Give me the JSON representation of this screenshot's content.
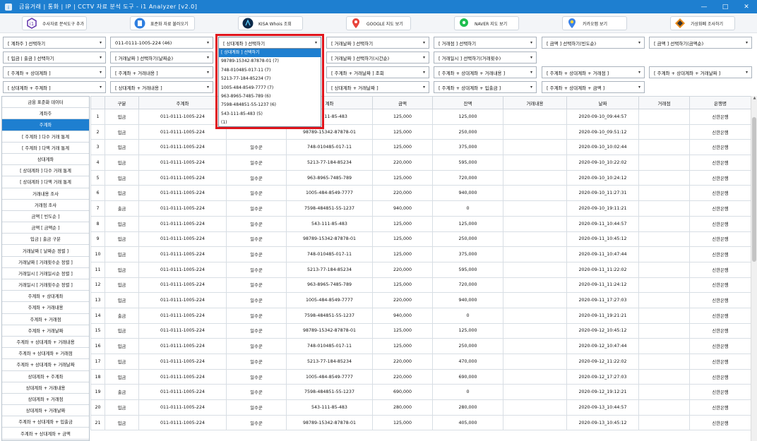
{
  "window": {
    "title": "금융거래 | 통화 | IP | CCTV 자료 분석 도구 - i1 Analyzer [v2.0]",
    "minimize": "—",
    "maximize": "□",
    "close": "✕"
  },
  "toolbar": {
    "buttons": [
      {
        "label": "수사자료 분석도구 추가",
        "icon": "i1-logo-icon"
      },
      {
        "label": "표준화 자료 불러오기",
        "icon": "document-icon"
      },
      {
        "label": "KISA Whois 조회",
        "icon": "kisa-logo-icon"
      },
      {
        "label": "GOOGLE 지도 보기",
        "icon": "google-maps-icon"
      },
      {
        "label": "NAVER 지도 보기",
        "icon": "naver-map-icon"
      },
      {
        "label": "카카오맵 보기",
        "icon": "kakao-map-icon"
      },
      {
        "label": "가상화폐 조사하기",
        "icon": "crypto-icon"
      }
    ]
  },
  "filters": {
    "row1": [
      "[ 계좌주 ] 선택하기",
      "011-0111-1005-224 (46)",
      "[ 상대계좌 ] 선택하기",
      "[ 거래날짜 ] 선택하기",
      "[ 거래점 ] 선택하기",
      "[ 금액 ] 선택하기(빈도순)",
      "[ 금액 ] 선택하기(금액순)"
    ],
    "row2": [
      "[ 입금 | 출금 ] 선택하기",
      "[ 거래날짜 ] 선택하기(날짜순)",
      "",
      "[ 거래날짜 ] 선택하기(시간순)",
      "[ 거래일시 ] 선택하기(거래횟수)"
    ],
    "row3": [
      "[ 주계좌 + 상대계좌 ]",
      "[ 주계좌 + 거래내용 ]",
      "",
      "[ 주계좌 + 거래날짜 ] 조회",
      "[ 주계좌 + 상대계좌 + 거래내용 ]",
      "[ 주계좌 + 상대계좌 + 거래점 ]",
      "[ 주계좌 + 상대계좌 + 거래날짜 ]"
    ],
    "row4": [
      "[ 상대계좌 + 주계좌 ]",
      "[ 상대계좌 + 거래내용 ]",
      "",
      "[ 상대계좌 + 거래날짜 ]",
      "[ 주계좌 + 상대계좌 + 입출금 ]",
      "[ 주계좌 + 상대계좌 + 금액 ]"
    ]
  },
  "dropdown_open": {
    "options": [
      "[ 상대계좌 ] 선택하기",
      "98789-15342-87878-01 (7)",
      "748-010485-017-11 (7)",
      "5213-77-184-85234 (7)",
      "1005-484-8549-7777 (7)",
      "963-8965-7485-789 (6)",
      "7598-484851-55-1237 (6)",
      "543-111-85-483 (5)",
      "(1)"
    ]
  },
  "sidebar": {
    "items": [
      "금융 표준화 데이터",
      "계좌주",
      "주계좌",
      "[ 주계좌 ] 다수 거래 통계",
      "[ 주계좌 ] 다액 거래 통계",
      "상대계좌",
      "[ 상대계좌 ] 다수 거래 통계",
      "[ 상대계좌 ] 다액 거래 통계",
      "거래내용 조사",
      "거래점 조사",
      "금액 [ 빈도순 ]",
      "금액 [ 금액순 ]",
      "입금 | 출금 구분",
      "거래날짜 [ 날짜순 정렬 ]",
      "거래날짜 [ 거래횟수순 정렬 ]",
      "거래일시 [ 거래일시순 정렬 ]",
      "거래일시 [ 거래횟수순 정렬 ]",
      "주계좌 + 상대계좌",
      "주계좌 + 거래내용",
      "주계좌 + 거래점",
      "주계좌 + 거래날짜",
      "주계좌 + 상대계좌 + 거래내용",
      "주계좌 + 상대계좌 + 거래점",
      "주계좌 + 상대계좌 + 거래날짜",
      "상대계좌 + 주계좌",
      "상대계좌 + 거래내용",
      "상대계좌 + 거래점",
      "상대계좌 + 거래날짜",
      "주계좌 + 상대계좌 + 입출금",
      "주계좌 + 상대계좌 + 금액"
    ]
  },
  "table": {
    "columns": [
      "",
      "구분",
      "주계좌",
      "",
      "계좌",
      "금액",
      "잔액",
      "거래내용",
      "날짜",
      "거래점",
      "은행명"
    ],
    "rows": [
      [
        "1",
        "입금",
        "011-0111-1005-224",
        "",
        "543-111-85-483",
        "125,000",
        "125,000",
        "",
        "2020-09-10_09:44:57",
        "",
        "신한은행"
      ],
      [
        "2",
        "입금",
        "011-0111-1005-224",
        "",
        "98789-15342-87878-01",
        "125,000",
        "250,000",
        "",
        "2020-09-10_09:51:12",
        "",
        "신한은행"
      ],
      [
        "3",
        "입금",
        "011-0111-1005-224",
        "일수꾼",
        "748-010485-017-11",
        "125,000",
        "375,000",
        "",
        "2020-09-10_10:02:44",
        "",
        "신한은행"
      ],
      [
        "4",
        "입금",
        "011-0111-1005-224",
        "일수꾼",
        "5213-77-184-85234",
        "220,000",
        "595,000",
        "",
        "2020-09-10_10:22:02",
        "",
        "신한은행"
      ],
      [
        "5",
        "입금",
        "011-0111-1005-224",
        "일수꾼",
        "963-8965-7485-789",
        "125,000",
        "720,000",
        "",
        "2020-09-10_10:24:12",
        "",
        "신한은행"
      ],
      [
        "6",
        "입금",
        "011-0111-1005-224",
        "일수꾼",
        "1005-484-8549-7777",
        "220,000",
        "940,000",
        "",
        "2020-09-10_11:27:31",
        "",
        "신한은행"
      ],
      [
        "7",
        "출금",
        "011-0111-1005-224",
        "일수꾼",
        "7598-484851-55-1237",
        "940,000",
        "0",
        "",
        "2020-09-10_19:11:21",
        "",
        "신한은행"
      ],
      [
        "8",
        "입금",
        "011-0111-1005-224",
        "일수꾼",
        "543-111-85-483",
        "125,000",
        "125,000",
        "",
        "2020-09-11_10:44:57",
        "",
        "신한은행"
      ],
      [
        "9",
        "입금",
        "011-0111-1005-224",
        "일수꾼",
        "98789-15342-87878-01",
        "125,000",
        "250,000",
        "",
        "2020-09-11_10:45:12",
        "",
        "신한은행"
      ],
      [
        "10",
        "입금",
        "011-0111-1005-224",
        "일수꾼",
        "748-010485-017-11",
        "125,000",
        "375,000",
        "",
        "2020-09-11_10:47:44",
        "",
        "신한은행"
      ],
      [
        "11",
        "입금",
        "011-0111-1005-224",
        "일수꾼",
        "5213-77-184-85234",
        "220,000",
        "595,000",
        "",
        "2020-09-11_11:22:02",
        "",
        "신한은행"
      ],
      [
        "12",
        "입금",
        "011-0111-1005-224",
        "일수꾼",
        "963-8965-7485-789",
        "125,000",
        "720,000",
        "",
        "2020-09-11_11:24:12",
        "",
        "신한은행"
      ],
      [
        "13",
        "입금",
        "011-0111-1005-224",
        "일수꾼",
        "1005-484-8549-7777",
        "220,000",
        "940,000",
        "",
        "2020-09-11_17:27:03",
        "",
        "신한은행"
      ],
      [
        "14",
        "출금",
        "011-0111-1005-224",
        "일수꾼",
        "7598-484851-55-1237",
        "940,000",
        "0",
        "",
        "2020-09-11_19:21:21",
        "",
        "신한은행"
      ],
      [
        "15",
        "입금",
        "011-0111-1005-224",
        "일수꾼",
        "98789-15342-87878-01",
        "125,000",
        "125,000",
        "",
        "2020-09-12_10:45:12",
        "",
        "신한은행"
      ],
      [
        "16",
        "입금",
        "011-0111-1005-224",
        "일수꾼",
        "748-010485-017-11",
        "125,000",
        "250,000",
        "",
        "2020-09-12_10:47:44",
        "",
        "신한은행"
      ],
      [
        "17",
        "입금",
        "011-0111-1005-224",
        "일수꾼",
        "5213-77-184-85234",
        "220,000",
        "470,000",
        "",
        "2020-09-12_11:22:02",
        "",
        "신한은행"
      ],
      [
        "18",
        "입금",
        "011-0111-1005-224",
        "일수꾼",
        "1005-484-8549-7777",
        "220,000",
        "690,000",
        "",
        "2020-09-12_17:27:03",
        "",
        "신한은행"
      ],
      [
        "19",
        "출금",
        "011-0111-1005-224",
        "일수꾼",
        "7598-484851-55-1237",
        "690,000",
        "0",
        "",
        "2020-09-12_19:12:21",
        "",
        "신한은행"
      ],
      [
        "20",
        "입금",
        "011-0111-1005-224",
        "일수꾼",
        "543-111-85-483",
        "280,000",
        "280,000",
        "",
        "2020-09-13_10:44:57",
        "",
        "신한은행"
      ],
      [
        "21",
        "입금",
        "011-0111-1005-224",
        "일수꾼",
        "98789-15342-87878-01",
        "125,000",
        "405,000",
        "",
        "2020-09-13_10:45:12",
        "",
        "신한은행"
      ]
    ]
  },
  "colors": {
    "accent": "#1e7fd0",
    "highlight_border": "#e0141b"
  }
}
